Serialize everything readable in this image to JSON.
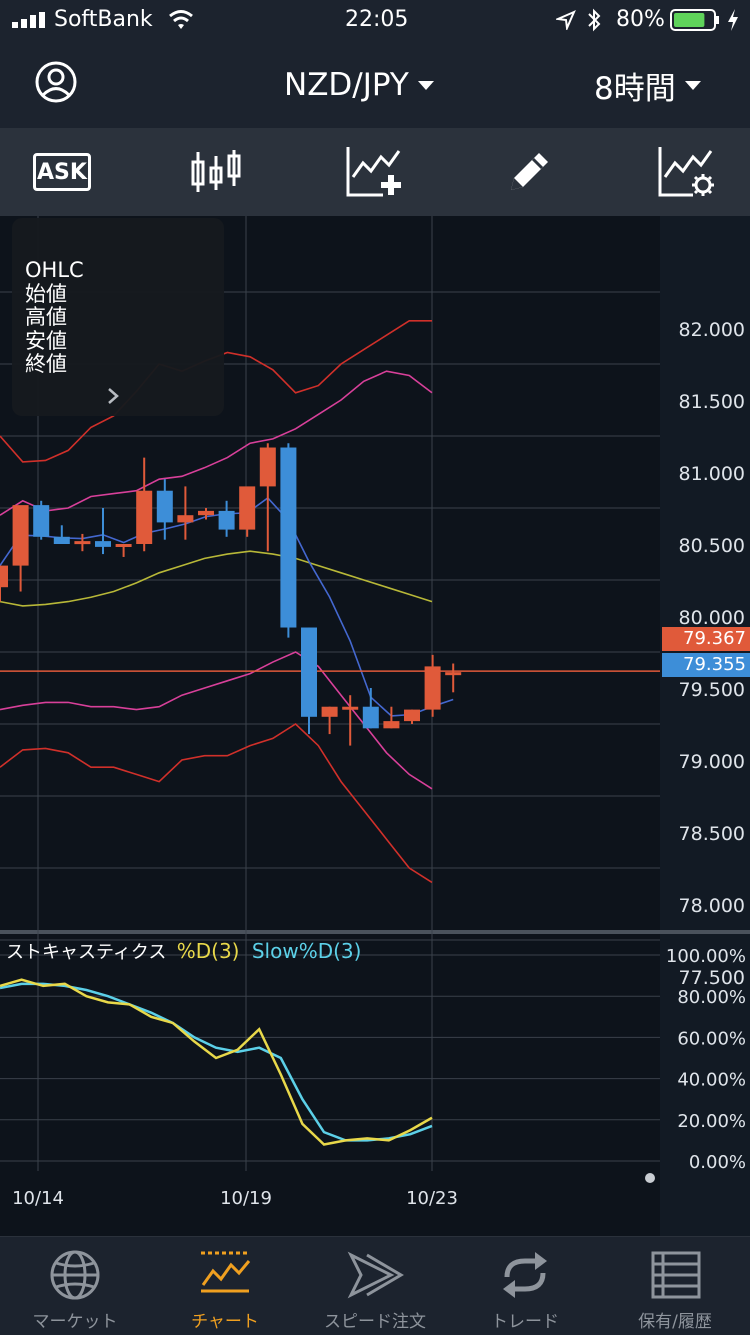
{
  "status_bar": {
    "carrier": "SoftBank",
    "time": "22:05",
    "battery_percent": "80%",
    "battery_level": 0.8
  },
  "header": {
    "pair": "NZD/JPY",
    "timeframe": "8時間"
  },
  "toolbar": {
    "ask_label": "ASK"
  },
  "ohlc_panel": {
    "lines": [
      "OHLC",
      "始値",
      "高値",
      "安値",
      "終値"
    ]
  },
  "price_axis": {
    "ticks": [
      "82.000",
      "81.500",
      "81.000",
      "80.500",
      "80.000",
      "79.500",
      "79.000",
      "78.500",
      "78.000",
      "77.500"
    ],
    "ask_price": "79.367",
    "bid_price": "79.355"
  },
  "indicator": {
    "name": "ストキャスティクス",
    "d_label": "%D(3)",
    "slow_label": "Slow%D(3)",
    "ticks": [
      "100.00%",
      "80.00%",
      "60.00%",
      "40.00%",
      "20.00%",
      "0.00%"
    ]
  },
  "date_axis": {
    "labels": [
      "10/14",
      "10/19",
      "10/23"
    ]
  },
  "colors": {
    "bull": "#e05a3a",
    "bear": "#3d8ed8",
    "band_outer": "#d0302a",
    "band_inner": "#d8409a",
    "middle": "#b8b838",
    "ma": "#4468d0",
    "stoch_d": "#e8d84a",
    "stoch_slow": "#5cd0e8",
    "active_tab": "#f0a020"
  },
  "chart_data": {
    "type": "candlestick",
    "pair": "NZD/JPY",
    "price_ylim": [
      77.5,
      82.0
    ],
    "x": [
      "10/14",
      "10/19",
      "10/23"
    ],
    "candles": [
      {
        "o": 79.95,
        "h": 80.1,
        "l": 79.85,
        "c": 80.1
      },
      {
        "o": 80.1,
        "h": 80.22,
        "l": 79.92,
        "c": 80.52
      },
      {
        "o": 80.52,
        "h": 80.55,
        "l": 80.28,
        "c": 80.3
      },
      {
        "o": 80.3,
        "h": 80.38,
        "l": 80.28,
        "c": 80.25
      },
      {
        "o": 80.25,
        "h": 80.32,
        "l": 80.2,
        "c": 80.27
      },
      {
        "o": 80.27,
        "h": 80.5,
        "l": 80.18,
        "c": 80.23
      },
      {
        "o": 80.23,
        "h": 80.23,
        "l": 80.16,
        "c": 80.25
      },
      {
        "o": 80.25,
        "h": 80.85,
        "l": 80.2,
        "c": 80.62
      },
      {
        "o": 80.62,
        "h": 80.7,
        "l": 80.28,
        "c": 80.4
      },
      {
        "o": 80.4,
        "h": 80.65,
        "l": 80.28,
        "c": 80.45
      },
      {
        "o": 80.45,
        "h": 80.5,
        "l": 80.42,
        "c": 80.48
      },
      {
        "o": 80.48,
        "h": 80.55,
        "l": 80.3,
        "c": 80.35
      },
      {
        "o": 80.35,
        "h": 80.55,
        "l": 80.3,
        "c": 80.65
      },
      {
        "o": 80.65,
        "h": 80.95,
        "l": 80.2,
        "c": 80.92
      },
      {
        "o": 80.92,
        "h": 80.95,
        "l": 79.6,
        "c": 79.67
      },
      {
        "o": 79.67,
        "h": 79.67,
        "l": 78.93,
        "c": 79.05
      },
      {
        "o": 79.05,
        "h": 79.12,
        "l": 78.93,
        "c": 79.12
      },
      {
        "o": 79.12,
        "h": 79.2,
        "l": 78.85,
        "c": 79.12
      },
      {
        "o": 79.12,
        "h": 79.25,
        "l": 78.97,
        "c": 78.97
      },
      {
        "o": 78.97,
        "h": 79.12,
        "l": 78.97,
        "c": 79.02
      },
      {
        "o": 79.02,
        "h": 79.1,
        "l": 79.0,
        "c": 79.1
      },
      {
        "o": 79.1,
        "h": 79.48,
        "l": 79.05,
        "c": 79.4
      },
      {
        "o": 79.36,
        "h": 79.42,
        "l": 79.22,
        "c": 79.36
      }
    ],
    "series": [
      {
        "values": [
          78.7,
          78.82,
          78.83,
          78.8,
          78.7,
          78.7,
          78.65,
          78.6,
          78.75,
          78.78,
          78.78,
          78.85,
          78.9,
          79.0,
          78.85,
          78.6,
          78.4,
          78.2,
          78.0,
          77.9
        ]
      },
      {
        "values": [
          79.1,
          79.13,
          79.15,
          79.15,
          79.12,
          79.12,
          79.1,
          79.12,
          79.2,
          79.25,
          79.3,
          79.35,
          79.43,
          79.5,
          79.4,
          79.2,
          79.0,
          78.8,
          78.65,
          78.55
        ]
      },
      {
        "values": [
          79.85,
          79.82,
          79.83,
          79.85,
          79.88,
          79.92,
          79.98,
          80.05,
          80.1,
          80.15,
          80.18,
          80.2,
          80.18,
          80.15,
          80.1,
          80.05,
          80.0,
          79.95,
          79.9,
          79.85
        ]
      },
      {
        "values": [
          80.45,
          80.55,
          80.48,
          80.5,
          80.58,
          80.6,
          80.62,
          80.7,
          80.72,
          80.78,
          80.85,
          80.95,
          80.98,
          81.05,
          81.15,
          81.25,
          81.38,
          81.45,
          81.42,
          81.3
        ]
      }
    ],
    "stochastic": {
      "ylim": [
        0,
        100
      ],
      "d": [
        85,
        88,
        85,
        86,
        80,
        77,
        76,
        70,
        67,
        58,
        50,
        54,
        64,
        42,
        18,
        8,
        10,
        11,
        10,
        15,
        21
      ],
      "slow_d": [
        84,
        86,
        86,
        85,
        83,
        80,
        76,
        72,
        67,
        60,
        55,
        53,
        55,
        50,
        30,
        14,
        10,
        10,
        11,
        13,
        17
      ]
    }
  },
  "bottom_nav": {
    "items": [
      {
        "label": "マーケット",
        "active": false
      },
      {
        "label": "チャート",
        "active": true
      },
      {
        "label": "スピード注文",
        "active": false
      },
      {
        "label": "トレード",
        "active": false
      },
      {
        "label": "保有/履歴",
        "active": false
      }
    ]
  }
}
